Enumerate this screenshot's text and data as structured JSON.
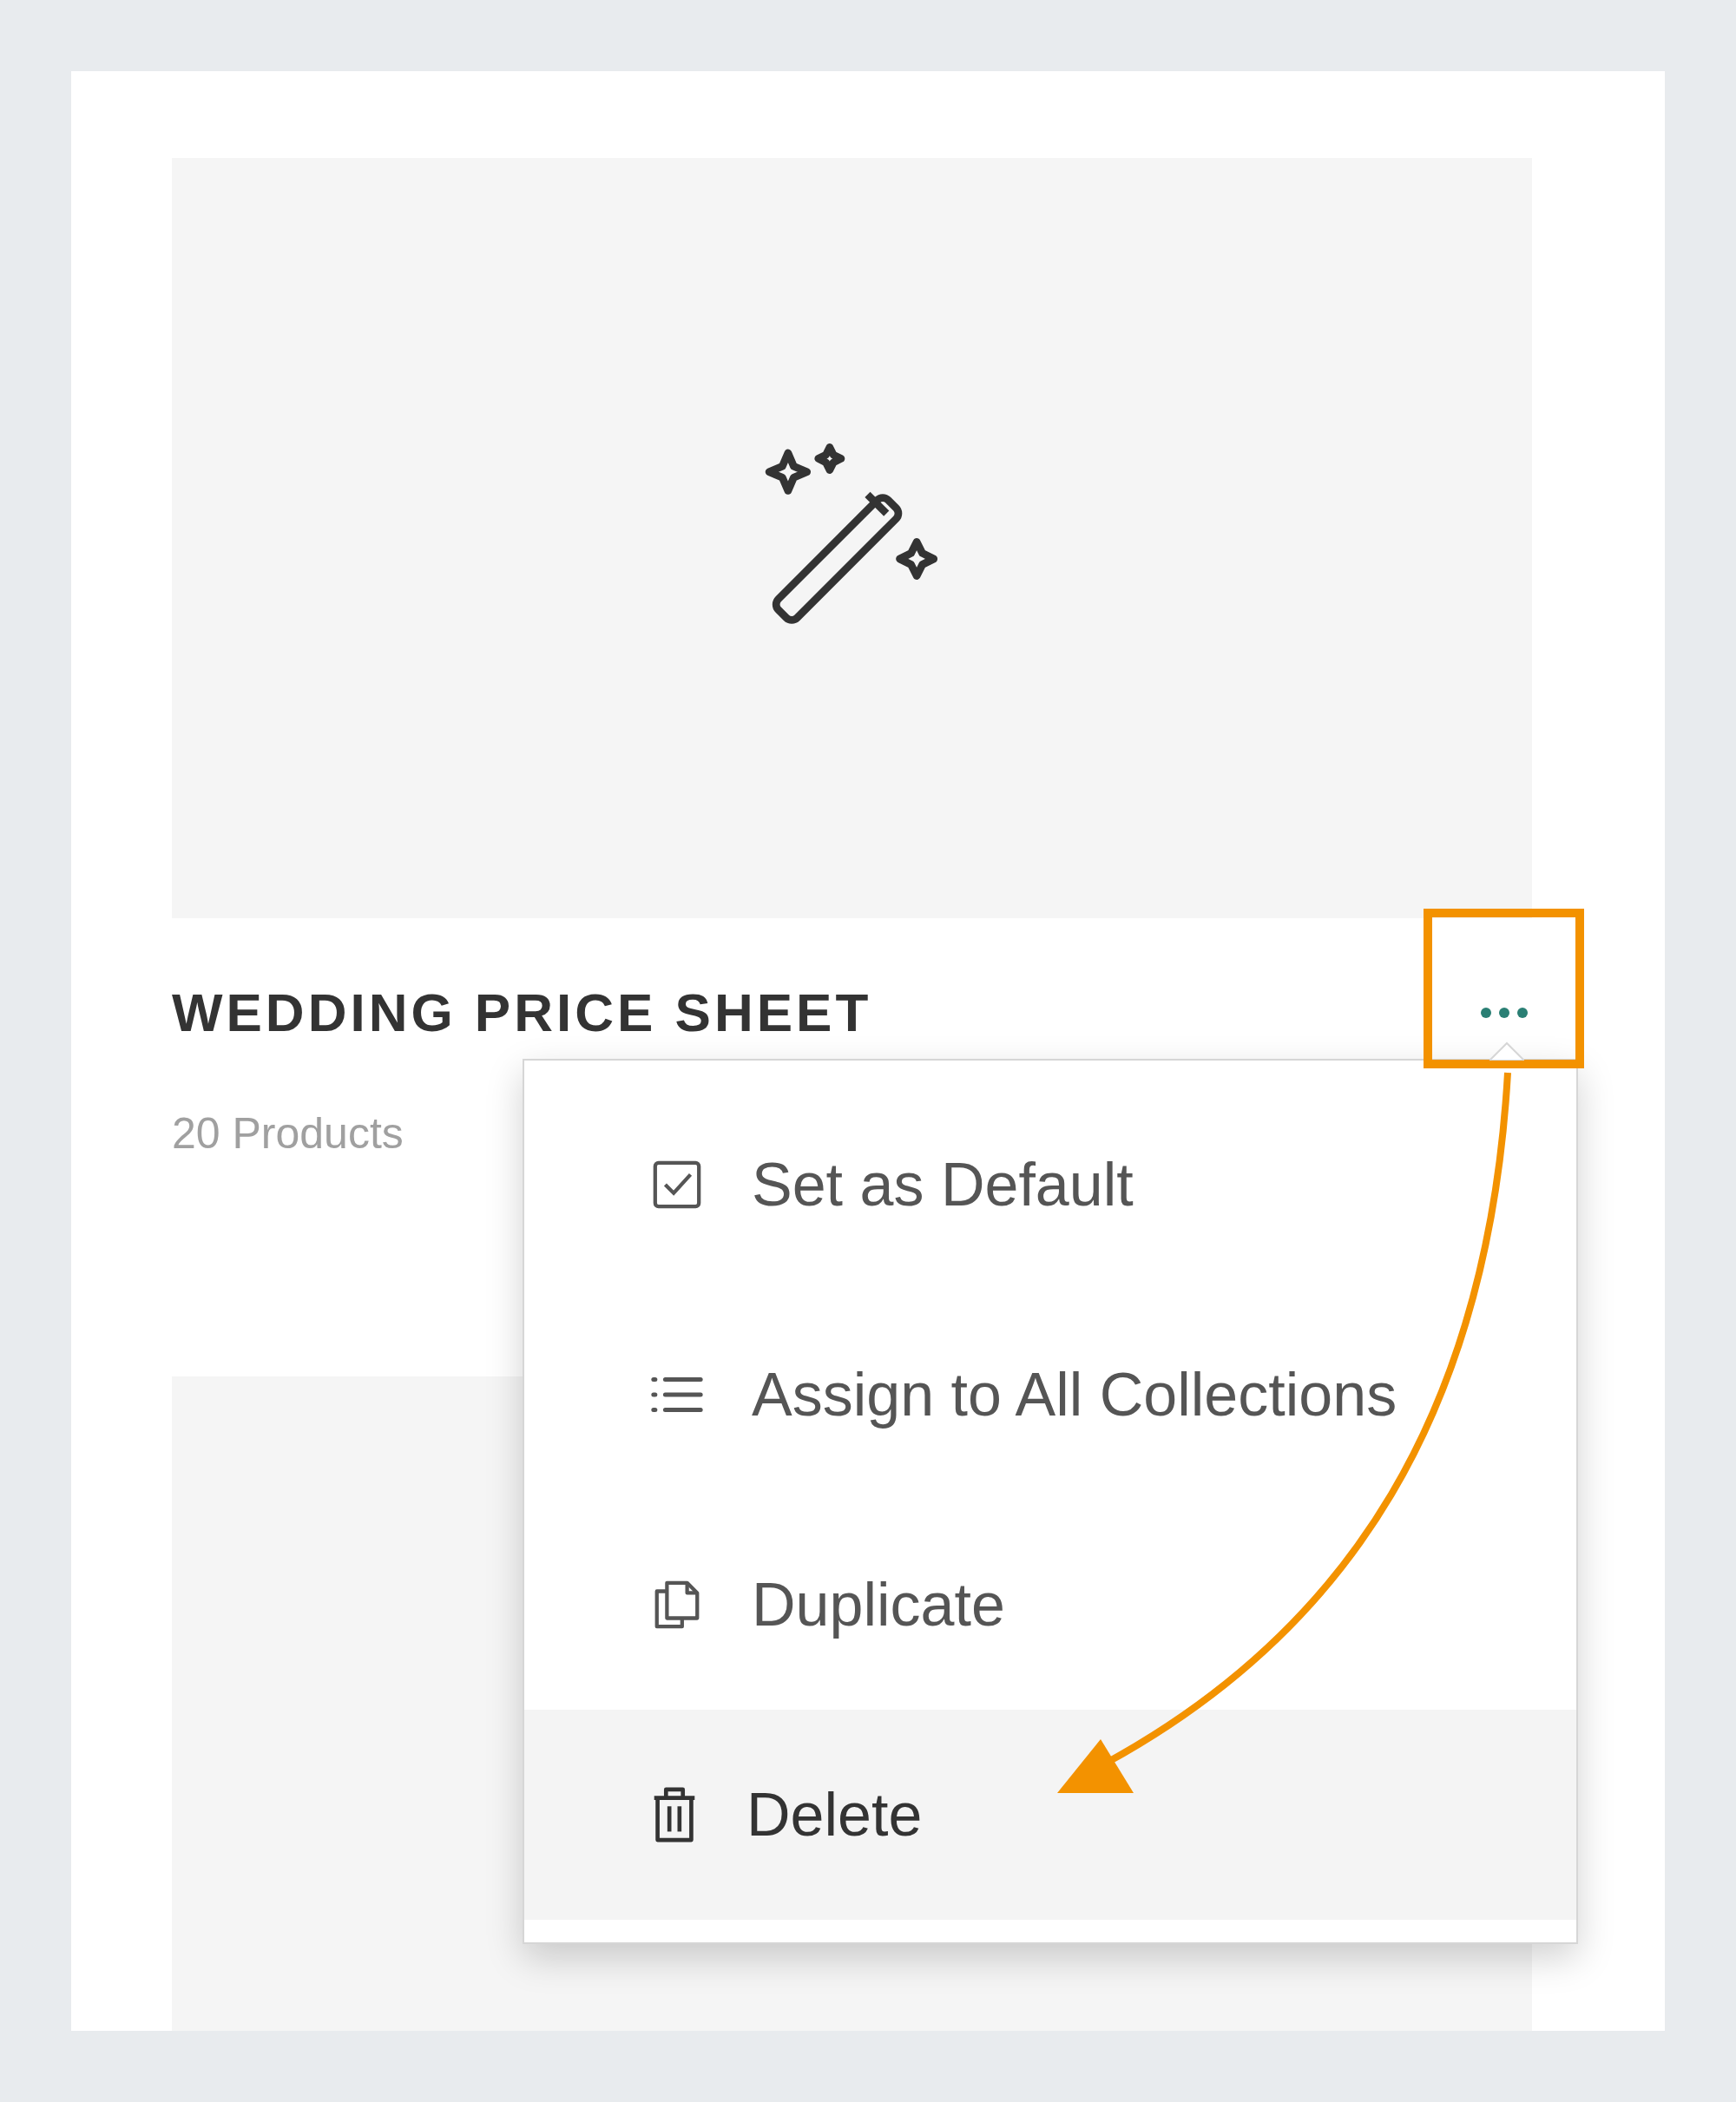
{
  "card": {
    "title": "WEDDING PRICE SHEET",
    "subtitle": "20 Products"
  },
  "menu": {
    "items": [
      {
        "label": "Set as Default",
        "highlighted": false
      },
      {
        "label": "Assign to All Collections",
        "highlighted": false
      },
      {
        "label": "Duplicate",
        "highlighted": false
      },
      {
        "label": "Delete",
        "highlighted": true
      }
    ]
  }
}
